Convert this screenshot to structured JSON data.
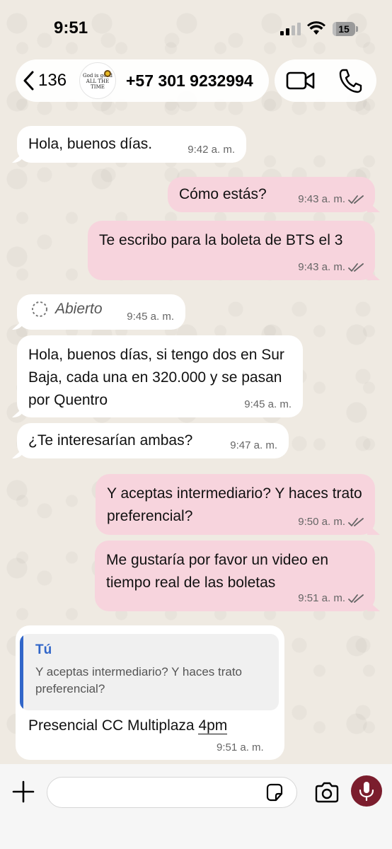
{
  "status_bar": {
    "time": "9:51",
    "battery_level": "15"
  },
  "header": {
    "back_count": "136",
    "avatar_text": "God is good ALL THE TIME",
    "contact_name": "+57 301 9232994",
    "video_icon": "video-camera-icon",
    "call_icon": "phone-icon"
  },
  "messages": [
    {
      "direction": "in",
      "text": "Hola, buenos días.",
      "time": "9:42 a. m."
    },
    {
      "direction": "out",
      "text": "Cómo estás?",
      "time": "9:43 a. m.",
      "status": "read"
    },
    {
      "direction": "out",
      "text": "Te escribo para la boleta de BTS el 3",
      "time": "9:43 a. m.",
      "status": "read"
    },
    {
      "direction": "in",
      "type": "view-once",
      "text": "Abierto",
      "time": "9:45 a. m."
    },
    {
      "direction": "in",
      "text": "Hola, buenos días, si tengo dos en Sur Baja, cada una en 320.000 y se pasan por Quentro",
      "time": "9:45 a. m."
    },
    {
      "direction": "in",
      "text": "¿Te interesarían ambas?",
      "time": "9:47 a. m."
    },
    {
      "direction": "out",
      "text": "Y aceptas intermediario? Y haces trato preferencial?",
      "time": "9:50 a. m.",
      "status": "read"
    },
    {
      "direction": "out",
      "text": "Me gustaría por favor un video en tiempo real de las boletas",
      "time": "9:51 a. m.",
      "status": "read"
    },
    {
      "direction": "in",
      "reply": {
        "author": "Tú",
        "text": "Y aceptas intermediario? Y haces trato preferencial?"
      },
      "text_pre": "Presencial CC Multiplaza ",
      "text_link": "4pm",
      "time": "9:51 a. m."
    }
  ],
  "composer": {
    "placeholder": "",
    "icons": [
      "plus-icon",
      "sticker-icon",
      "camera-icon",
      "microphone-icon"
    ]
  },
  "colors": {
    "incoming_bubble": "#ffffff",
    "outgoing_bubble": "#f7d4dd",
    "quote_accent": "#3166c9",
    "mic_button": "#7b1d2d",
    "wallpaper": "#efeae2"
  }
}
